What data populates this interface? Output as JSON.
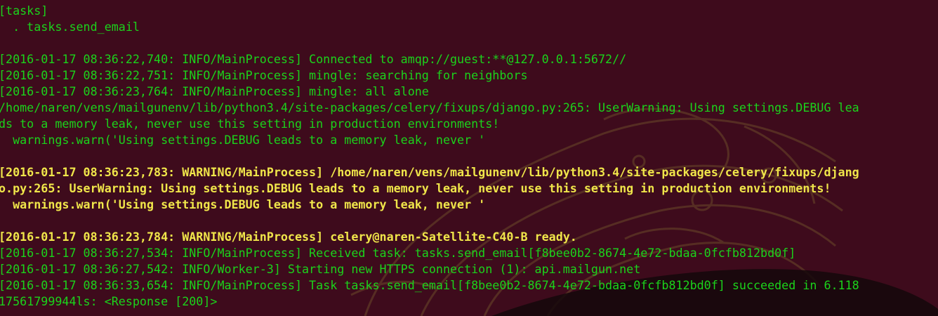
{
  "colors": {
    "background": "#3e0b1c",
    "info_text": "#1bd31b",
    "warning_text": "#f0e64a"
  },
  "terminal": {
    "lines": [
      {
        "text": "[tasks]",
        "level": "info"
      },
      {
        "text": "  . tasks.send_email",
        "level": "info"
      },
      {
        "text": "",
        "level": "info"
      },
      {
        "text": "[2016-01-17 08:36:22,740: INFO/MainProcess] Connected to amqp://guest:**@127.0.0.1:5672//",
        "level": "info"
      },
      {
        "text": "[2016-01-17 08:36:22,751: INFO/MainProcess] mingle: searching for neighbors",
        "level": "info"
      },
      {
        "text": "[2016-01-17 08:36:23,764: INFO/MainProcess] mingle: all alone",
        "level": "info"
      },
      {
        "text": "/home/naren/vens/mailgunenv/lib/python3.4/site-packages/celery/fixups/django.py:265: UserWarning: Using settings.DEBUG lea",
        "level": "info"
      },
      {
        "text": "ds to a memory leak, never use this setting in production environments!",
        "level": "info"
      },
      {
        "text": "  warnings.warn('Using settings.DEBUG leads to a memory leak, never '",
        "level": "info"
      },
      {
        "text": "",
        "level": "info"
      },
      {
        "text": "[2016-01-17 08:36:23,783: WARNING/MainProcess] /home/naren/vens/mailgunenv/lib/python3.4/site-packages/celery/fixups/djang",
        "level": "warning"
      },
      {
        "text": "o.py:265: UserWarning: Using settings.DEBUG leads to a memory leak, never use this setting in production environments!",
        "level": "warning"
      },
      {
        "text": "  warnings.warn('Using settings.DEBUG leads to a memory leak, never '",
        "level": "warning"
      },
      {
        "text": "",
        "level": "info"
      },
      {
        "text": "[2016-01-17 08:36:23,784: WARNING/MainProcess] celery@naren-Satellite-C40-B ready.",
        "level": "warning"
      },
      {
        "text": "[2016-01-17 08:36:27,534: INFO/MainProcess] Received task: tasks.send_email[f8bee0b2-8674-4e72-bdaa-0fcfb812bd0f]",
        "level": "info"
      },
      {
        "text": "[2016-01-17 08:36:27,542: INFO/Worker-3] Starting new HTTPS connection (1): api.mailgun.net",
        "level": "info"
      },
      {
        "text": "[2016-01-17 08:36:33,654: INFO/MainProcess] Task tasks.send_email[f8bee0b2-8674-4e72-bdaa-0fcfb812bd0f] succeeded in 6.118",
        "level": "info"
      },
      {
        "text": "17561799944ls: <Response [200]>",
        "level": "info"
      }
    ]
  }
}
